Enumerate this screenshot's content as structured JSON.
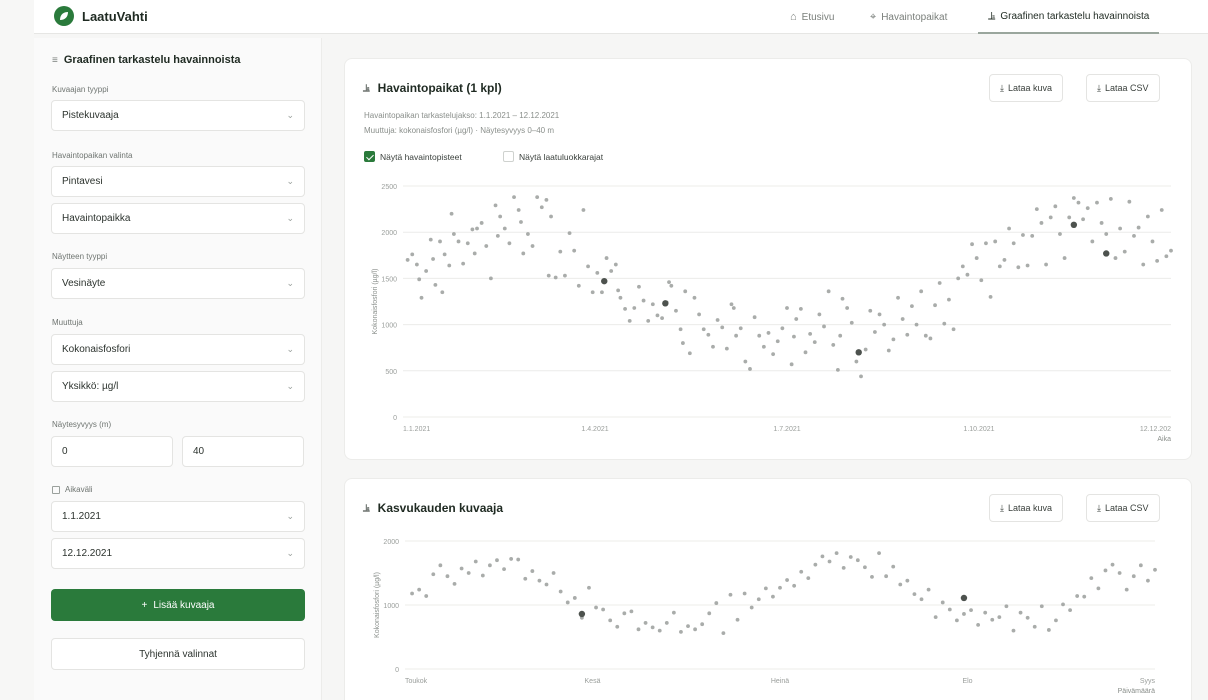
{
  "app": {
    "brand": "LaatuVahti",
    "nav": [
      {
        "label": "Etusivu",
        "icon": "home-icon"
      },
      {
        "label": "Havaintopaikat",
        "icon": "map-pin-icon"
      },
      {
        "label": "Graafinen tarkastelu havainnoista",
        "icon": "chart-icon"
      }
    ]
  },
  "sidebar": {
    "title": "Graafinen tarkastelu havainnoista",
    "chart_type_label": "Kuvaajan tyyppi",
    "chart_type_value": "Pistekuvaaja",
    "site_label": "Havaintopaikan valinta",
    "water_value": "Pintavesi",
    "site_value": "Havaintopaikka",
    "sample_type_label": "Näytteen tyyppi",
    "sample_type_value": "Vesinäyte",
    "variable_label": "Muuttuja",
    "variable_value": "Kokonaisfosfori",
    "unit_value": "Yksikkö: µg/l",
    "depth_label": "Näytesyvyys (m)",
    "depth_min": "0",
    "depth_max": "40",
    "range_label": "Aikaväli",
    "date_from": "1.1.2021",
    "date_to": "12.12.2021",
    "add_button": "Lisää kuvaaja",
    "clear_button": "Tyhjennä valinnat"
  },
  "card1": {
    "title": "Havaintopaikat (1 kpl)",
    "download_image": "Lataa kuva",
    "download_csv": "Lataa CSV",
    "period": "Havaintopaikan tarkastelujakso: 1.1.2021 – 12.12.2021",
    "variable_line": "Muuttuja: kokonaisfosfori (µg/l) · Näytesyvyys 0–40 m",
    "show_points": "Näytä havaintopisteet",
    "show_limits": "Näytä laatuluokkarajat"
  },
  "card2": {
    "title": "Kasvukauden kuvaaja",
    "download_image": "Lataa kuva",
    "download_csv": "Lataa CSV"
  },
  "chart_data": [
    {
      "type": "scatter",
      "ylabel": "Kokonaisfosfori (µg/l)",
      "xlabel": "Aika",
      "ylim": [
        0,
        2500
      ],
      "yticks": [
        "0",
        "500",
        "1000",
        "1500",
        "2000",
        "2500"
      ],
      "xticks": [
        "1.1.2021",
        "1.4.2021",
        "1.7.2021",
        "1.10.2021",
        "12.12.202"
      ],
      "grid": true,
      "point_color": "#9a9e9b",
      "highlight_color": "#4d524e",
      "points": [
        [
          0.01,
          1700
        ],
        [
          0.02,
          1760
        ],
        [
          0.03,
          1650
        ],
        [
          0.035,
          1490
        ],
        [
          0.04,
          1290
        ],
        [
          0.05,
          1580
        ],
        [
          0.06,
          1920
        ],
        [
          0.065,
          1710
        ],
        [
          0.07,
          1430
        ],
        [
          0.08,
          1900
        ],
        [
          0.085,
          1350
        ],
        [
          0.09,
          1760
        ],
        [
          0.1,
          1640
        ],
        [
          0.105,
          2200
        ],
        [
          0.11,
          1980
        ],
        [
          0.12,
          1900
        ],
        [
          0.13,
          1660
        ],
        [
          0.14,
          1880
        ],
        [
          0.15,
          2030
        ],
        [
          0.155,
          1770
        ],
        [
          0.16,
          2040
        ],
        [
          0.17,
          2100
        ],
        [
          0.18,
          1850
        ],
        [
          0.19,
          1500
        ],
        [
          0.2,
          2290
        ],
        [
          0.205,
          1960
        ],
        [
          0.21,
          2170
        ],
        [
          0.22,
          2040
        ],
        [
          0.23,
          1880
        ],
        [
          0.24,
          2380
        ],
        [
          0.25,
          2240
        ],
        [
          0.255,
          2110
        ],
        [
          0.26,
          1770
        ],
        [
          0.27,
          1980
        ],
        [
          0.28,
          1850
        ],
        [
          0.29,
          2380
        ],
        [
          0.3,
          2270
        ],
        [
          0.31,
          2350
        ],
        [
          0.315,
          1530
        ],
        [
          0.32,
          2170
        ],
        [
          0.33,
          1510
        ],
        [
          0.34,
          1790
        ],
        [
          0.35,
          1530
        ],
        [
          0.36,
          1990
        ],
        [
          0.37,
          1800
        ],
        [
          0.38,
          1420
        ],
        [
          0.39,
          2240
        ],
        [
          0.4,
          1630
        ],
        [
          0.41,
          1350
        ],
        [
          0.42,
          1560
        ],
        [
          0.43,
          1350
        ],
        [
          0.44,
          1720
        ],
        [
          0.45,
          1580
        ],
        [
          0.46,
          1650
        ],
        [
          0.465,
          1370
        ],
        [
          0.47,
          1290
        ],
        [
          0.48,
          1170
        ],
        [
          0.49,
          1040
        ],
        [
          0.5,
          1180
        ],
        [
          0.51,
          1410
        ],
        [
          0.52,
          1260
        ],
        [
          0.53,
          1040
        ],
        [
          0.54,
          1220
        ],
        [
          0.55,
          1100
        ],
        [
          0.56,
          1070
        ],
        [
          0.57,
          1240
        ],
        [
          0.575,
          1460
        ],
        [
          0.58,
          1420
        ],
        [
          0.59,
          1150
        ],
        [
          0.6,
          950
        ],
        [
          0.605,
          800
        ],
        [
          0.61,
          1360
        ],
        [
          0.62,
          690
        ],
        [
          0.63,
          1290
        ],
        [
          0.64,
          1110
        ],
        [
          0.65,
          950
        ],
        [
          0.66,
          890
        ],
        [
          0.67,
          760
        ],
        [
          0.68,
          1050
        ],
        [
          0.69,
          970
        ],
        [
          0.7,
          740
        ],
        [
          0.71,
          1220
        ],
        [
          0.715,
          1180
        ],
        [
          0.72,
          880
        ],
        [
          0.73,
          960
        ],
        [
          0.74,
          600
        ],
        [
          0.75,
          520
        ],
        [
          0.76,
          1080
        ],
        [
          0.77,
          880
        ],
        [
          0.78,
          760
        ],
        [
          0.79,
          910
        ],
        [
          0.8,
          680
        ],
        [
          0.81,
          820
        ],
        [
          0.82,
          960
        ],
        [
          0.83,
          1180
        ],
        [
          0.84,
          570
        ],
        [
          0.845,
          870
        ],
        [
          0.85,
          1060
        ],
        [
          0.86,
          1170
        ],
        [
          0.87,
          700
        ],
        [
          0.88,
          900
        ],
        [
          0.89,
          810
        ],
        [
          0.9,
          1110
        ],
        [
          0.91,
          980
        ],
        [
          0.92,
          1360
        ],
        [
          0.93,
          780
        ],
        [
          0.94,
          510
        ],
        [
          0.945,
          880
        ],
        [
          0.95,
          1280
        ],
        [
          0.96,
          1180
        ],
        [
          0.97,
          1020
        ],
        [
          0.98,
          600
        ],
        [
          0.99,
          440
        ],
        [
          1.0,
          730
        ],
        [
          1.01,
          1150
        ],
        [
          1.02,
          920
        ],
        [
          1.03,
          1110
        ],
        [
          1.04,
          1000
        ],
        [
          1.05,
          720
        ],
        [
          1.06,
          840
        ],
        [
          1.07,
          1290
        ],
        [
          1.08,
          1060
        ],
        [
          1.09,
          890
        ],
        [
          1.1,
          1200
        ],
        [
          1.11,
          1000
        ],
        [
          1.12,
          1360
        ],
        [
          1.13,
          880
        ],
        [
          1.14,
          850
        ],
        [
          1.15,
          1210
        ],
        [
          1.16,
          1450
        ],
        [
          1.17,
          1010
        ],
        [
          1.18,
          1270
        ],
        [
          1.19,
          950
        ],
        [
          1.2,
          1500
        ],
        [
          1.21,
          1630
        ],
        [
          1.22,
          1540
        ],
        [
          1.23,
          1870
        ],
        [
          1.24,
          1720
        ],
        [
          1.25,
          1480
        ],
        [
          1.26,
          1880
        ],
        [
          1.27,
          1300
        ],
        [
          1.28,
          1900
        ],
        [
          1.29,
          1630
        ],
        [
          1.3,
          1700
        ],
        [
          1.31,
          2040
        ],
        [
          1.32,
          1880
        ],
        [
          1.33,
          1620
        ],
        [
          1.34,
          1970
        ],
        [
          1.35,
          1640
        ],
        [
          1.36,
          1960
        ],
        [
          1.37,
          2250
        ],
        [
          1.38,
          2100
        ],
        [
          1.39,
          1650
        ],
        [
          1.4,
          2160
        ],
        [
          1.41,
          2280
        ],
        [
          1.42,
          1980
        ],
        [
          1.43,
          1720
        ],
        [
          1.44,
          2160
        ],
        [
          1.45,
          2370
        ],
        [
          1.46,
          2320
        ],
        [
          1.47,
          2140
        ],
        [
          1.48,
          2260
        ],
        [
          1.49,
          1900
        ],
        [
          1.5,
          2320
        ],
        [
          1.51,
          2100
        ],
        [
          1.52,
          1980
        ],
        [
          1.53,
          2360
        ],
        [
          1.54,
          1720
        ],
        [
          1.55,
          2040
        ],
        [
          1.56,
          1790
        ],
        [
          1.57,
          2330
        ],
        [
          1.58,
          1960
        ],
        [
          1.59,
          2050
        ],
        [
          1.6,
          1650
        ],
        [
          1.61,
          2170
        ],
        [
          1.62,
          1900
        ],
        [
          1.63,
          1690
        ],
        [
          1.64,
          2240
        ],
        [
          1.65,
          1740
        ],
        [
          1.66,
          1800
        ]
      ],
      "highlights": [
        [
          0.435,
          1470
        ],
        [
          0.567,
          1230
        ],
        [
          0.985,
          700
        ],
        [
          1.45,
          2080
        ],
        [
          1.52,
          1770
        ]
      ]
    },
    {
      "type": "scatter",
      "ylabel": "Kokonaisfosfori (µg/l)",
      "xlabel": "Päivämäärä",
      "ylim": [
        0,
        2000
      ],
      "yticks": [
        "0",
        "1000",
        "2000"
      ],
      "xticks": [
        "Toukok",
        "Kesä",
        "Heinä",
        "Elo",
        "Syys"
      ],
      "grid": true,
      "point_color": "#9a9e9b",
      "highlight_color": "#4d524e",
      "points": [
        [
          0.01,
          1180
        ],
        [
          0.02,
          1240
        ],
        [
          0.03,
          1140
        ],
        [
          0.04,
          1480
        ],
        [
          0.05,
          1620
        ],
        [
          0.06,
          1450
        ],
        [
          0.07,
          1330
        ],
        [
          0.08,
          1570
        ],
        [
          0.09,
          1500
        ],
        [
          0.1,
          1680
        ],
        [
          0.11,
          1460
        ],
        [
          0.12,
          1620
        ],
        [
          0.13,
          1700
        ],
        [
          0.14,
          1560
        ],
        [
          0.15,
          1720
        ],
        [
          0.16,
          1710
        ],
        [
          0.17,
          1410
        ],
        [
          0.18,
          1530
        ],
        [
          0.19,
          1380
        ],
        [
          0.2,
          1320
        ],
        [
          0.21,
          1500
        ],
        [
          0.22,
          1210
        ],
        [
          0.23,
          1040
        ],
        [
          0.24,
          1110
        ],
        [
          0.25,
          800
        ],
        [
          0.26,
          1270
        ],
        [
          0.27,
          960
        ],
        [
          0.28,
          930
        ],
        [
          0.29,
          760
        ],
        [
          0.3,
          660
        ],
        [
          0.31,
          870
        ],
        [
          0.32,
          900
        ],
        [
          0.33,
          620
        ],
        [
          0.34,
          720
        ],
        [
          0.35,
          650
        ],
        [
          0.36,
          600
        ],
        [
          0.37,
          720
        ],
        [
          0.38,
          880
        ],
        [
          0.39,
          580
        ],
        [
          0.4,
          670
        ],
        [
          0.41,
          620
        ],
        [
          0.42,
          700
        ],
        [
          0.43,
          870
        ],
        [
          0.44,
          1030
        ],
        [
          0.45,
          560
        ],
        [
          0.46,
          1160
        ],
        [
          0.47,
          770
        ],
        [
          0.48,
          1180
        ],
        [
          0.49,
          960
        ],
        [
          0.5,
          1090
        ],
        [
          0.51,
          1260
        ],
        [
          0.52,
          1130
        ],
        [
          0.53,
          1270
        ],
        [
          0.54,
          1390
        ],
        [
          0.55,
          1300
        ],
        [
          0.56,
          1520
        ],
        [
          0.57,
          1420
        ],
        [
          0.58,
          1630
        ],
        [
          0.59,
          1760
        ],
        [
          0.6,
          1680
        ],
        [
          0.61,
          1810
        ],
        [
          0.62,
          1580
        ],
        [
          0.63,
          1750
        ],
        [
          0.64,
          1700
        ],
        [
          0.65,
          1590
        ],
        [
          0.66,
          1440
        ],
        [
          0.67,
          1810
        ],
        [
          0.68,
          1450
        ],
        [
          0.69,
          1600
        ],
        [
          0.7,
          1320
        ],
        [
          0.71,
          1380
        ],
        [
          0.72,
          1170
        ],
        [
          0.73,
          1090
        ],
        [
          0.74,
          1240
        ],
        [
          0.75,
          810
        ],
        [
          0.76,
          1040
        ],
        [
          0.77,
          930
        ],
        [
          0.78,
          760
        ],
        [
          0.79,
          860
        ],
        [
          0.8,
          920
        ],
        [
          0.81,
          690
        ],
        [
          0.82,
          880
        ],
        [
          0.83,
          770
        ],
        [
          0.84,
          810
        ],
        [
          0.85,
          980
        ],
        [
          0.86,
          600
        ],
        [
          0.87,
          880
        ],
        [
          0.88,
          800
        ],
        [
          0.89,
          660
        ],
        [
          0.9,
          980
        ],
        [
          0.91,
          610
        ],
        [
          0.92,
          760
        ],
        [
          0.93,
          1010
        ],
        [
          0.94,
          920
        ],
        [
          0.95,
          1140
        ],
        [
          0.96,
          1130
        ],
        [
          0.97,
          1420
        ],
        [
          0.98,
          1260
        ],
        [
          0.99,
          1540
        ],
        [
          1.0,
          1630
        ],
        [
          1.01,
          1500
        ],
        [
          1.02,
          1240
        ],
        [
          1.03,
          1450
        ],
        [
          1.04,
          1620
        ],
        [
          1.05,
          1380
        ],
        [
          1.06,
          1550
        ]
      ],
      "highlights": [
        [
          0.25,
          860
        ],
        [
          0.79,
          1110
        ]
      ]
    }
  ]
}
